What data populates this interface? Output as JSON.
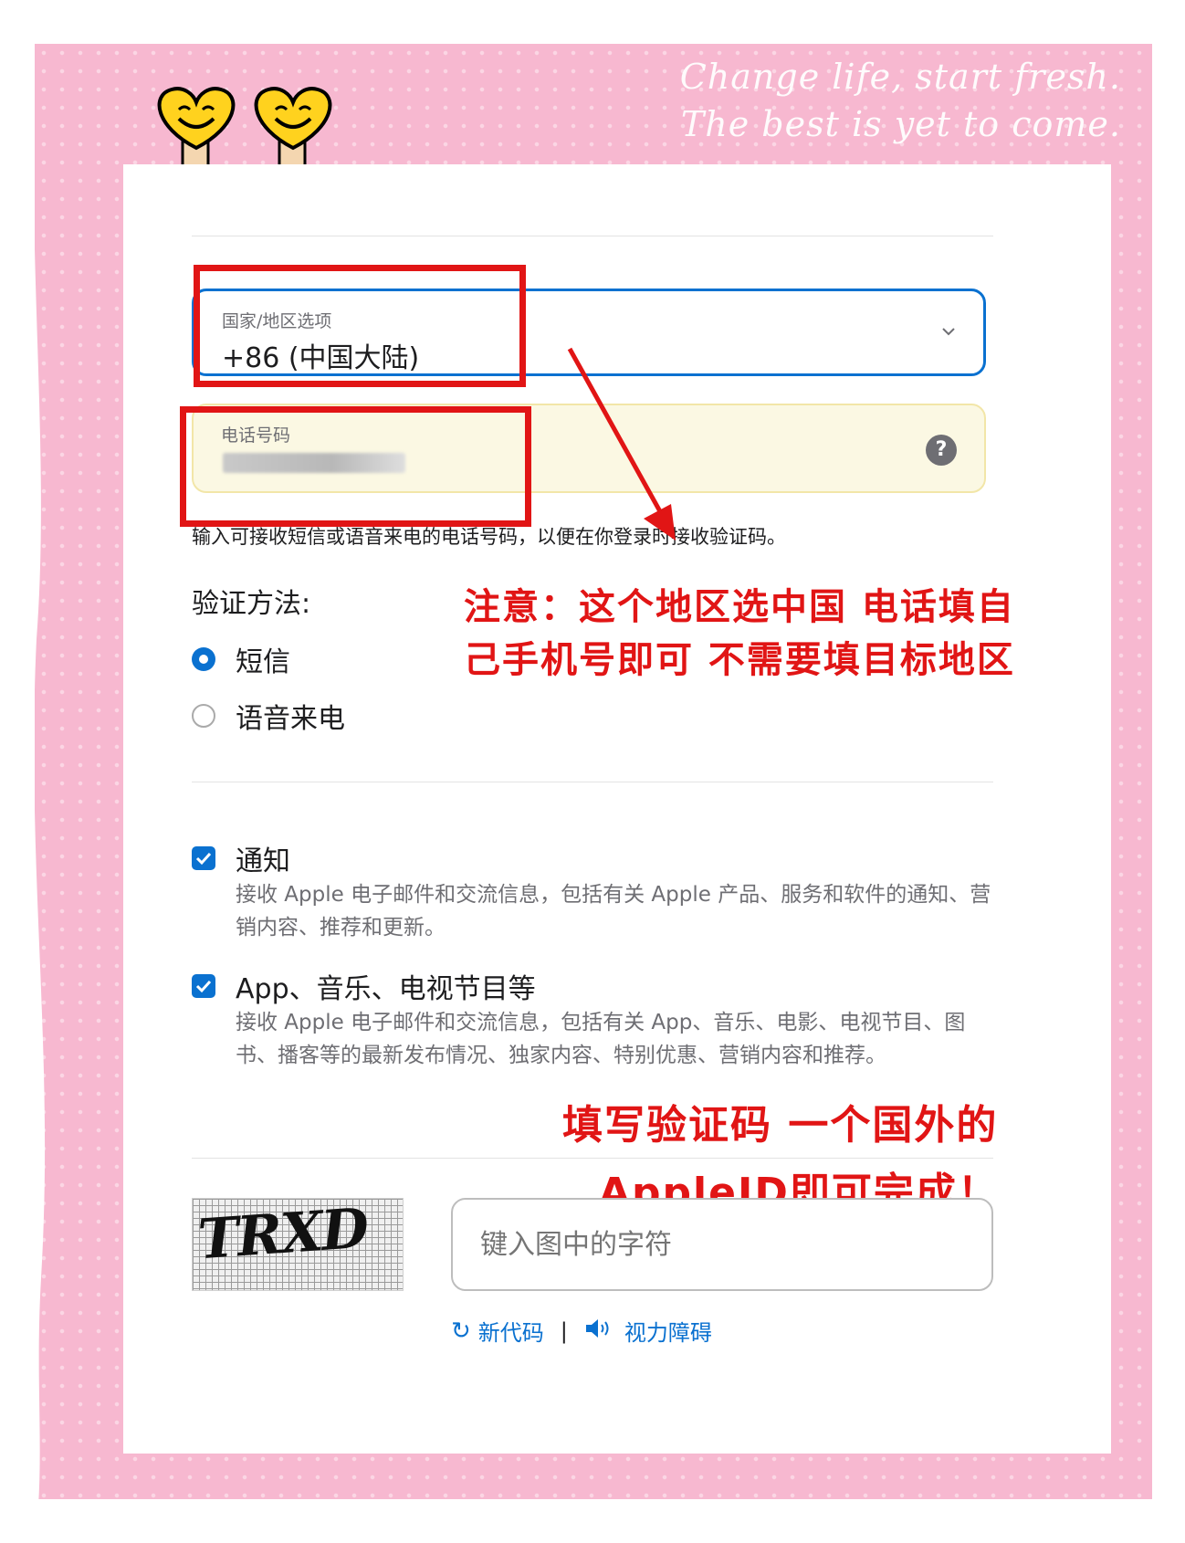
{
  "tagline": {
    "line1": "Change life, start fresh.",
    "line2": "The best is yet to come."
  },
  "country": {
    "label": "国家/地区选项",
    "value": "+86 (中国大陆)"
  },
  "phone": {
    "label": "电话号码"
  },
  "hint": "输入可接收短信或语音来电的电话号码，以便在你登录时接收验证码。",
  "verification": {
    "title": "验证方法:",
    "options": [
      {
        "label": "短信",
        "selected": true
      },
      {
        "label": "语音来电",
        "selected": false
      }
    ]
  },
  "annotation1": {
    "line1": "注意：这个地区选中国  电话填自",
    "line2": "己手机号即可  不需要填目标地区"
  },
  "subscriptions": [
    {
      "label": "通知",
      "checked": true,
      "desc": "接收 Apple 电子邮件和交流信息，包括有关 Apple 产品、服务和软件的通知、营销内容、推荐和更新。"
    },
    {
      "label": "App、音乐、电视节目等",
      "checked": true,
      "desc": "接收 Apple 电子邮件和交流信息，包括有关 App、音乐、电影、电视节目、图书、播客等的最新发布情况、独家内容、特别优惠、营销内容和推荐。"
    }
  ],
  "annotation2": {
    "line1": "填写验证码  一个国外的",
    "line2": "AppleID即可完成！"
  },
  "captcha": {
    "text": "TRXD",
    "placeholder": "键入图中的字符"
  },
  "links": {
    "new_code": "新代码",
    "separator": "|",
    "vision": "视力障碍"
  },
  "colors": {
    "accent": "#0a71d0",
    "annotation": "#e11515",
    "frame": "#f7b8d0"
  }
}
